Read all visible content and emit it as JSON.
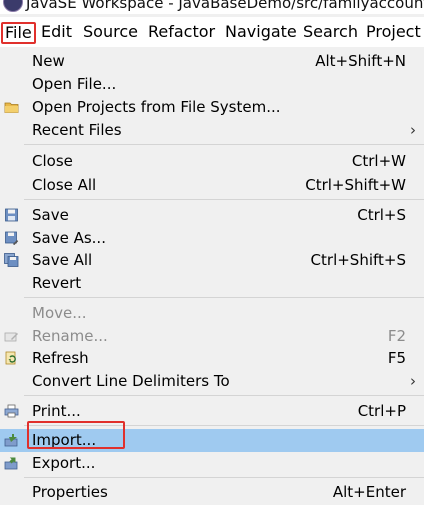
{
  "window": {
    "title": "JavaSE Workspace - JavaBaseDemo/src/familyaccounts"
  },
  "menubar": {
    "items": [
      "File",
      "Edit",
      "Source",
      "Refactor",
      "Navigate",
      "Search",
      "Project"
    ]
  },
  "file_menu": {
    "items": [
      {
        "label": "New",
        "shortcut": "Alt+Shift+N",
        "submenu": true,
        "icon": "",
        "enabled": true
      },
      {
        "label": "Open File...",
        "shortcut": "",
        "submenu": false,
        "icon": "",
        "enabled": true
      },
      {
        "label": "Open Projects from File System...",
        "shortcut": "",
        "submenu": false,
        "icon": "folder-icon",
        "enabled": true
      },
      {
        "label": "Recent Files",
        "shortcut": "",
        "submenu": true,
        "icon": "",
        "enabled": true
      },
      {
        "label": "Close",
        "shortcut": "Ctrl+W",
        "submenu": false,
        "icon": "",
        "enabled": true
      },
      {
        "label": "Close All",
        "shortcut": "Ctrl+Shift+W",
        "submenu": false,
        "icon": "",
        "enabled": true
      },
      {
        "label": "Save",
        "shortcut": "Ctrl+S",
        "submenu": false,
        "icon": "save-icon",
        "enabled": true
      },
      {
        "label": "Save As...",
        "shortcut": "",
        "submenu": false,
        "icon": "save-as-icon",
        "enabled": true
      },
      {
        "label": "Save All",
        "shortcut": "Ctrl+Shift+S",
        "submenu": false,
        "icon": "save-all-icon",
        "enabled": true
      },
      {
        "label": "Revert",
        "shortcut": "",
        "submenu": false,
        "icon": "",
        "enabled": true
      },
      {
        "label": "Move...",
        "shortcut": "",
        "submenu": false,
        "icon": "",
        "enabled": false
      },
      {
        "label": "Rename...",
        "shortcut": "F2",
        "submenu": false,
        "icon": "rename-icon",
        "enabled": false
      },
      {
        "label": "Refresh",
        "shortcut": "F5",
        "submenu": false,
        "icon": "refresh-icon",
        "enabled": true
      },
      {
        "label": "Convert Line Delimiters To",
        "shortcut": "",
        "submenu": true,
        "icon": "",
        "enabled": true
      },
      {
        "label": "Print...",
        "shortcut": "Ctrl+P",
        "submenu": false,
        "icon": "print-icon",
        "enabled": true
      },
      {
        "label": "Import...",
        "shortcut": "",
        "submenu": false,
        "icon": "import-icon",
        "enabled": true,
        "highlighted": true
      },
      {
        "label": "Export...",
        "shortcut": "",
        "submenu": false,
        "icon": "export-icon",
        "enabled": true
      },
      {
        "label": "Properties",
        "shortcut": "Alt+Enter",
        "submenu": false,
        "icon": "",
        "enabled": true
      }
    ],
    "submenu_arrow": "›"
  },
  "colors": {
    "menu_background": "#f0f0f0",
    "highlight": "#9fcaf0",
    "annotation_box": "#e0302c",
    "disabled_text": "#8c8c8c"
  }
}
